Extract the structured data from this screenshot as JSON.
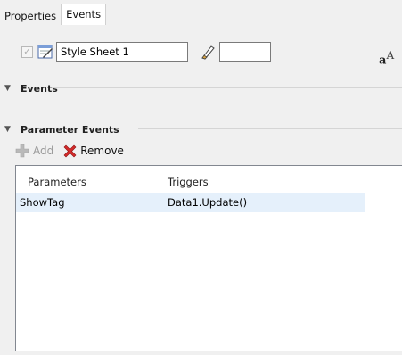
{
  "tabs": [
    {
      "label": "Properties",
      "active": false
    },
    {
      "label": "Events",
      "active": true
    }
  ],
  "style_sheet": {
    "name": "Style Sheet 1",
    "checked": true
  },
  "sections": {
    "events": {
      "label": "Events",
      "expanded": true
    },
    "parameter_events": {
      "label": "Parameter Events",
      "expanded": true
    }
  },
  "toolbar": {
    "add_label": "Add",
    "remove_label": "Remove",
    "add_enabled": false
  },
  "table": {
    "headers": [
      "Parameters",
      "Triggers"
    ],
    "rows": [
      {
        "parameter": "ShowTag",
        "trigger": "Data1.Update()",
        "selected": true
      }
    ]
  },
  "icons": {
    "font": "font-size-icon",
    "brush": "brush-icon",
    "stylesheet": "stylesheet-icon",
    "add": "plus-icon",
    "remove": "red-x-icon"
  },
  "colors": {
    "selection": "#e5f0fb",
    "remove_icon": "#d42a2a",
    "add_icon_disabled": "#b9b9b9"
  }
}
